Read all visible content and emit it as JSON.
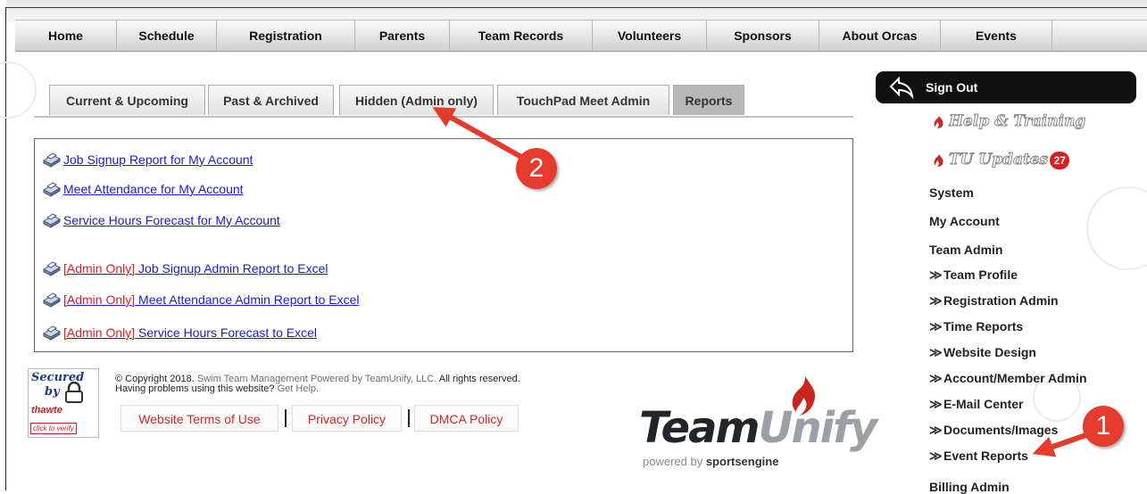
{
  "nav": {
    "items": [
      "Home",
      "Schedule",
      "Registration",
      "Parents",
      "Team Records",
      "Volunteers",
      "Sponsors",
      "About Orcas",
      "Events"
    ]
  },
  "tabs": [
    {
      "label": "Current & Upcoming",
      "active": false
    },
    {
      "label": "Past & Archived",
      "active": false
    },
    {
      "label": "Hidden (Admin only)",
      "active": false
    },
    {
      "label": "TouchPad Meet Admin",
      "active": false
    },
    {
      "label": "Reports",
      "active": true
    }
  ],
  "reports": {
    "admin_prefix": "[Admin Only]",
    "links": [
      {
        "label": "Job Signup Report for My Account",
        "admin": false
      },
      {
        "label": "Meet Attendance for My Account",
        "admin": false
      },
      {
        "label": "Service Hours Forecast for My Account",
        "admin": false
      },
      {
        "label": " Job Signup Admin Report to Excel",
        "admin": true
      },
      {
        "label": " Meet Attendance Admin Report to Excel",
        "admin": true
      },
      {
        "label": " Service Hours Forecast to Excel",
        "admin": true
      }
    ]
  },
  "footer": {
    "copyright_line1_a": "© Copyright 2018. ",
    "copyright_line1_b": "Swim Team Management Powered by TeamUnify, LLC.",
    "copyright_line1_c": " All rights reserved.",
    "copyright_line2_a": "Having problems using this website? ",
    "copyright_line2_b": "Get Help.",
    "links": [
      "Website Terms of Use",
      "Privacy Policy",
      "DMCA Policy"
    ],
    "seal": {
      "line1": "Secured",
      "line2": "by",
      "line3": "thawte",
      "line4": "click to verify"
    }
  },
  "logo": {
    "word_a": "Team",
    "word_b": "Unify",
    "sub_a": "powered by ",
    "sub_b": "sportsengine"
  },
  "sidebar": {
    "signout": "Sign Out",
    "help": "Help & Training",
    "updates": "TU Updates",
    "updates_count": "27",
    "headings": [
      "System",
      "My Account",
      "Team Admin"
    ],
    "team_admin_items": [
      "Team Profile",
      "Registration Admin",
      "Time Reports",
      "Website Design",
      "Account/Member Admin",
      "E-Mail Center",
      "Documents/Images",
      "Event Reports"
    ],
    "billing": "Billing Admin"
  },
  "annotations": {
    "callout_1": "1",
    "callout_2": "2"
  },
  "colors": {
    "link": "#1a1ad6",
    "admin_red": "#e21b1b",
    "callout": "#e53b2c",
    "signout_bg": "#111111"
  }
}
